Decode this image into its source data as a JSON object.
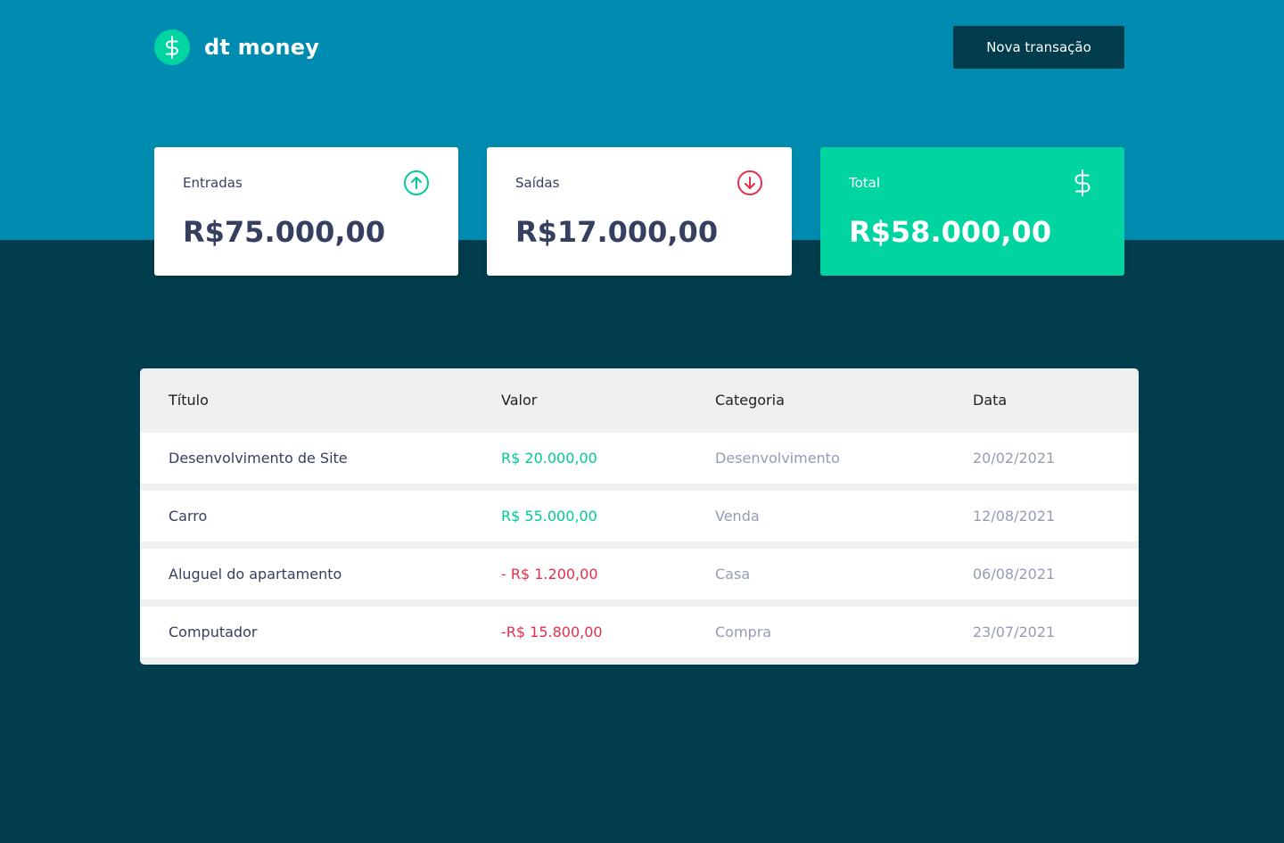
{
  "header": {
    "app_name": "dt money",
    "new_transaction_label": "Nova transação"
  },
  "summary": {
    "income": {
      "label": "Entradas",
      "value": "R$75.000,00",
      "icon": "arrow-up-circle-icon"
    },
    "outcome": {
      "label": "Saídas",
      "value": "R$17.000,00",
      "icon": "arrow-down-circle-icon"
    },
    "total": {
      "label": "Total",
      "value": "R$58.000,00",
      "icon": "dollar-icon"
    }
  },
  "table": {
    "headers": {
      "title": "Título",
      "amount": "Valor",
      "category": "Categoria",
      "date": "Data"
    },
    "rows": [
      {
        "title": "Desenvolvimento de Site",
        "amount": "R$ 20.000,00",
        "type": "deposit",
        "category": "Desenvolvimento",
        "date": "20/02/2021"
      },
      {
        "title": "Carro",
        "amount": "R$ 55.000,00",
        "type": "deposit",
        "category": "Venda",
        "date": "12/08/2021"
      },
      {
        "title": "Aluguel do apartamento",
        "amount": "- R$ 1.200,00",
        "type": "withdraw",
        "category": "Casa",
        "date": "06/08/2021"
      },
      {
        "title": "Computador",
        "amount": "-R$ 15.800,00",
        "type": "withdraw",
        "category": "Compra",
        "date": "23/07/2021"
      }
    ]
  },
  "colors": {
    "header_bg": "#008cb0",
    "page_bg": "#003d4d",
    "button_bg": "#013c4c",
    "green": "#00d5a2",
    "red": "#e52e4d",
    "text": "#363f5f",
    "muted": "#969cb3"
  }
}
